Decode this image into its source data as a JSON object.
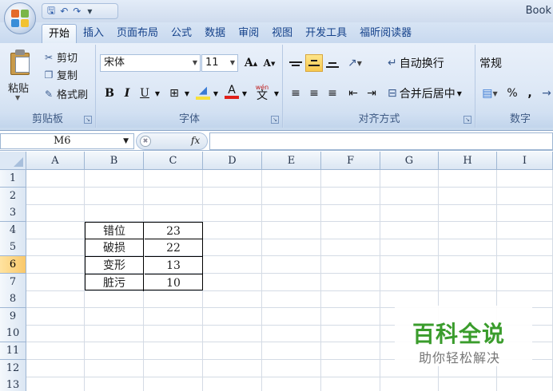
{
  "window": {
    "title": "Book"
  },
  "ribbon_tabs": [
    "开始",
    "插入",
    "页面布局",
    "公式",
    "数据",
    "审阅",
    "视图",
    "开发工具",
    "福昕阅读器"
  ],
  "clipboard": {
    "paste": "粘贴",
    "cut": "剪切",
    "copy": "复制",
    "format_painter": "格式刷",
    "label": "剪贴板"
  },
  "font": {
    "name": "宋体",
    "size": "11",
    "bold": "B",
    "italic": "I",
    "underline": "U",
    "grow": "A",
    "shrink": "A",
    "color_letter": "A",
    "phonetic": "wén",
    "label": "字体",
    "font_color": "#e0201a",
    "fill_color": "#f7e03c"
  },
  "alignment": {
    "wrap_text": "自动换行",
    "merge_center": "合并后居中",
    "label": "对齐方式"
  },
  "number": {
    "format": "常规",
    "percent": "%",
    "comma": ",",
    "label": "数字"
  },
  "formula_bar": {
    "name_box": "M6",
    "fx": "fx"
  },
  "columns": [
    "A",
    "B",
    "C",
    "D",
    "E",
    "F",
    "G",
    "H",
    "I"
  ],
  "rows": [
    "1",
    "2",
    "3",
    "4",
    "5",
    "6",
    "7",
    "8",
    "9",
    "10",
    "11",
    "12",
    "13"
  ],
  "active_row": "6",
  "table": [
    {
      "label": "错位",
      "value": "23"
    },
    {
      "label": "破损",
      "value": "22"
    },
    {
      "label": "变形",
      "value": "13"
    },
    {
      "label": "脏污",
      "value": "10"
    }
  ],
  "watermark": {
    "title": "百科全说",
    "subtitle": "助你轻松解决"
  }
}
